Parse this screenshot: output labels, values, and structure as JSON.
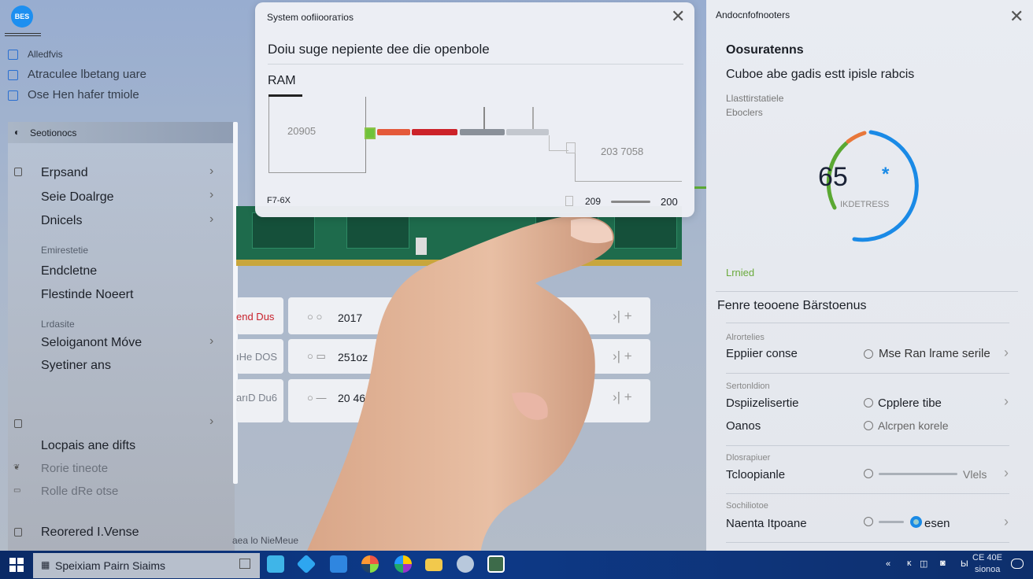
{
  "user": {
    "avatar": "BES"
  },
  "checklist": [
    "Alledfvis",
    "Atraculee lbetang uare",
    "Ose Hen hafer tmiole"
  ],
  "left_panel": {
    "header": "Seotionocs",
    "items": [
      {
        "label": "Erpsand",
        "chevron": true
      },
      {
        "label": "Seie Doalrge",
        "chevron": true
      },
      {
        "label": "Dnicels",
        "chevron": true
      }
    ],
    "section1": "Emirestetie",
    "items2": [
      "Endcletne",
      "Flestinde Noeert"
    ],
    "section2": "Lrdasite",
    "items3": [
      {
        "label": "Seloiganont Móve",
        "chevron": true
      },
      {
        "label": "Syetiner ans"
      }
    ],
    "items4": [
      "Locpais ane difts",
      "Rorie tineote",
      "Rolle dRe otse"
    ],
    "footer_item": "Reorered I.Vense"
  },
  "dialog": {
    "title": "System oofiioorатios",
    "heading": "Doiu suge nepiente dee die openbole",
    "tab": "RAM",
    "left_value": "20905",
    "right_value": "203 7058",
    "footer_left": "F7-6X",
    "footer_mid": "209",
    "footer_right": "200",
    "bar_colors": [
      "#e4593a",
      "#cc2229",
      "#8a9099",
      "#c3c7ce"
    ]
  },
  "rows": [
    {
      "label": "end Dus",
      "value": "2017",
      "accent": "#c8202a"
    },
    {
      "label": "ıHe DOS",
      "value": "251oz"
    },
    {
      "label": "arıD Du6",
      "value": "20 46"
    }
  ],
  "caption": "aea lo NieMeue",
  "right_panel": {
    "title": "Andocnfofnooters",
    "heading": "Oosuratenns",
    "subheading": "Cuboe abe gadis estt ipisle rabcis",
    "meta1": "Llasttirstatiele",
    "meta2": "Eboclers",
    "gauge": {
      "value": "65",
      "label": "IKDETRESS",
      "percent": 65,
      "colors": [
        "#5aa832",
        "#e8773a",
        "#1a8ae6"
      ]
    },
    "status": "Lrnied",
    "section_title": "Fenre teooene Bärstoenus",
    "groups": [
      {
        "label": "Alrortelies",
        "rows": [
          {
            "name": "Eppiier conse",
            "option": "Mse Ran lrame serile",
            "chevron": true
          }
        ]
      },
      {
        "label": "Sertonldion",
        "rows": [
          {
            "name": "Dspiizelisertie",
            "option": "Cpplere tibe",
            "chevron": true
          },
          {
            "name": "Oanos",
            "option": "Alcrpen korele"
          }
        ]
      },
      {
        "label": "Dlosrapiuer",
        "rows": [
          {
            "name": "Tcloopianle",
            "option": "Vlels",
            "chevron": true
          }
        ]
      },
      {
        "label": "Sochiliotoe",
        "rows": [
          {
            "name": "Naenta Itpoane",
            "option": "esen",
            "chevron": true
          }
        ]
      }
    ]
  },
  "taskbar": {
    "search": "Speixiam Pairn Siaims",
    "clock_time": "CE 40E",
    "clock_date": "sionoa",
    "app_icons": [
      "camera-app",
      "diamond-app",
      "document-app",
      "color-ball-app",
      "palette-app",
      "folder-app",
      "cloud-app",
      "photo-app"
    ]
  }
}
